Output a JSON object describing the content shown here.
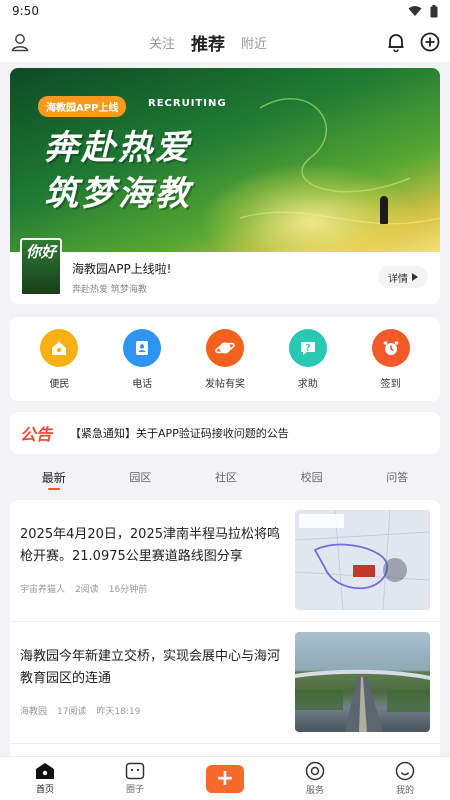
{
  "status_bar": {
    "time": "9:50"
  },
  "top_nav": {
    "tabs": [
      {
        "label": "关注"
      },
      {
        "label": "推荐"
      },
      {
        "label": "附近"
      }
    ]
  },
  "banner": {
    "badge": "海教园APP上线",
    "recruiting": "RECRUITING",
    "line1": "奔赴热爱",
    "line2": "筑梦海教",
    "thumb_text": "你好",
    "title": "海教园APP上线啦!",
    "subtitle": "奔赴热爱 筑梦海教",
    "detail_label": "详情"
  },
  "quick_actions": [
    {
      "label": "便民",
      "color": "#f9b015"
    },
    {
      "label": "电话",
      "color": "#2e95f0"
    },
    {
      "label": "发帖有奖",
      "color": "#f2621d"
    },
    {
      "label": "求助",
      "color": "#29c8b3"
    },
    {
      "label": "签到",
      "color": "#f25a2b"
    }
  ],
  "notice": {
    "tag": "公告",
    "text": "【紧急通知】关于APP验证码接收问题的公告"
  },
  "categories": [
    {
      "label": "最新"
    },
    {
      "label": "园区"
    },
    {
      "label": "社区"
    },
    {
      "label": "校园"
    },
    {
      "label": "问答"
    }
  ],
  "feed": [
    {
      "title": "2025年4月20日，2025津南半程马拉松将鸣枪开赛。21.0975公里赛道路线图分享",
      "author": "宇宙养猫人",
      "reads": "2阅读",
      "time": "16分钟前"
    },
    {
      "title": "海教园今年新建立交桥，实现会展中心与海河教育园区的连通",
      "author": "海教园",
      "reads": "17阅读",
      "time": "昨天18:19"
    }
  ],
  "bottom_tabs": [
    {
      "label": "首页"
    },
    {
      "label": "圈子"
    },
    {
      "label": "+"
    },
    {
      "label": "服务"
    },
    {
      "label": "我的"
    }
  ],
  "colors": {
    "accent": "#f6692c",
    "notice_red": "#f04b32"
  }
}
